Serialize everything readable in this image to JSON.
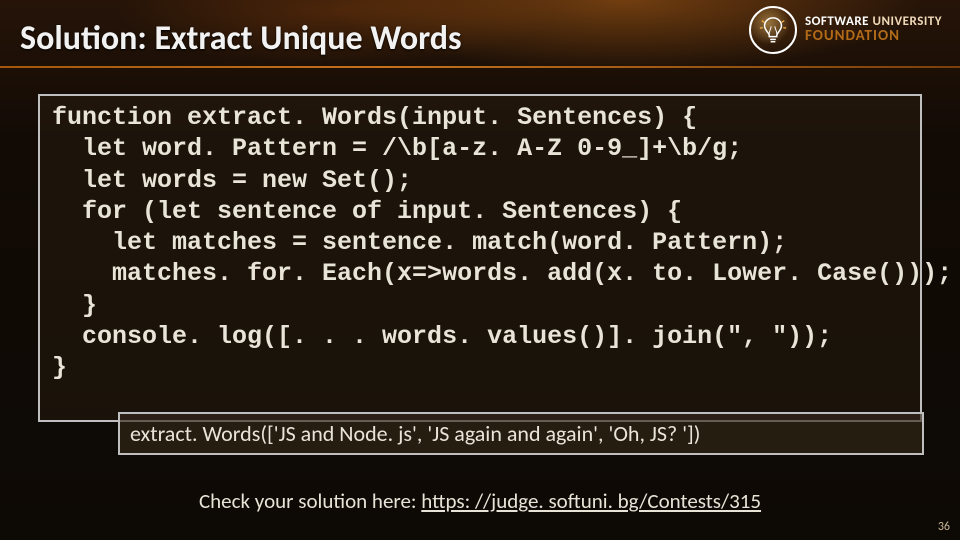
{
  "title": "Solution: Extract Unique Words",
  "logo": {
    "line1": "SOFTWARE",
    "line2": "UNIVERSITY",
    "line3": "FOUNDATION"
  },
  "code": {
    "l1": "function extract. Words(input. Sentences) {",
    "l2": "  let word. Pattern = /\\b[a-z. A-Z 0-9_]+\\b/g;",
    "l3": "  let words = new Set();",
    "l4": "  for (let sentence of input. Sentences) {",
    "l5": "    let matches = sentence. match(word. Pattern);",
    "l6": "    matches. for. Each(x=>words. add(x. to. Lower. Case()));",
    "l7": "  }",
    "l8": "  console. log([. . . words. values()]. join(\", \"));",
    "l9": "}"
  },
  "call": "extract. Words(['JS and Node. js', 'JS again and again', 'Oh, JS? '])",
  "footer_prefix": "Check your solution here: ",
  "footer_link": "https: //judge. softuni. bg/Contests/315",
  "page_number": "36"
}
